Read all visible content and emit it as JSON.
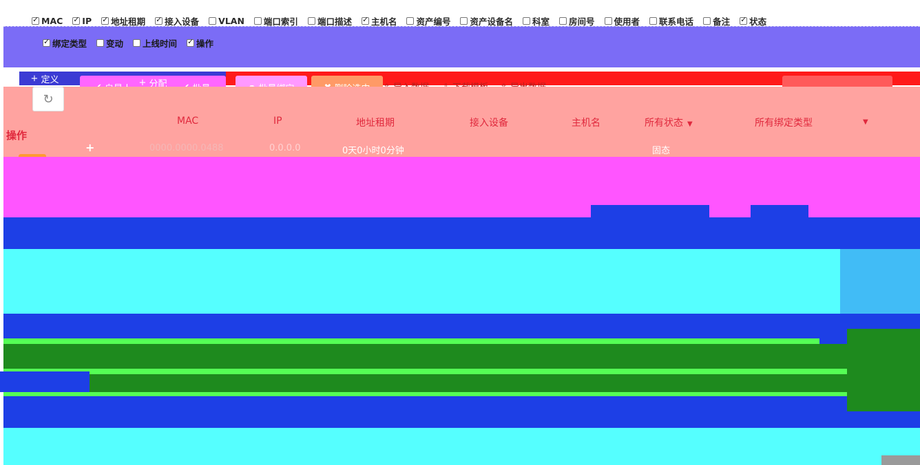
{
  "columns": {
    "row1": [
      {
        "label": "MAC",
        "checked": true
      },
      {
        "label": "IP",
        "checked": true
      },
      {
        "label": "地址租期",
        "checked": true
      },
      {
        "label": "接入设备",
        "checked": true
      },
      {
        "label": "VLAN",
        "checked": false
      },
      {
        "label": "端口索引",
        "checked": false
      },
      {
        "label": "端口描述",
        "checked": false
      },
      {
        "label": "主机名",
        "checked": true
      },
      {
        "label": "资产编号",
        "checked": false
      },
      {
        "label": "资产设备名",
        "checked": false
      },
      {
        "label": "科室",
        "checked": false
      },
      {
        "label": "房间号",
        "checked": false
      },
      {
        "label": "使用者",
        "checked": false
      },
      {
        "label": "联系电话",
        "checked": false
      },
      {
        "label": "备注",
        "checked": false
      },
      {
        "label": "状态",
        "checked": true
      }
    ],
    "row2": [
      {
        "label": "绑定类型",
        "checked": true
      },
      {
        "label": "变动",
        "checked": false
      },
      {
        "label": "上线时间",
        "checked": false
      },
      {
        "label": "操作",
        "checked": true
      }
    ]
  },
  "toolbar": {
    "custom_label": "定义",
    "show_unconfirmed_label": "自是人显示",
    "assign_label": "分配",
    "batch_label": "批量",
    "batch_bind_label": "批量绑定",
    "delete_selected_label": "删除选中",
    "import_label": "导入数据",
    "download_template_label": "下载模板",
    "export_label": "导出数据",
    "refresh_icon": "refresh-icon"
  },
  "table": {
    "headers": {
      "op": "操作",
      "mac": "MAC",
      "ip": "IP",
      "lease": "地址租期",
      "device": "接入设备",
      "hostname": "主机名",
      "state": "所有状态",
      "bind_type": "所有绑定类型"
    },
    "row0": {
      "plus": "+",
      "mac": "0000.0000.0488",
      "ip": "0.0.0.0",
      "lease": "0天0小时0分钟",
      "state": "固态"
    }
  }
}
